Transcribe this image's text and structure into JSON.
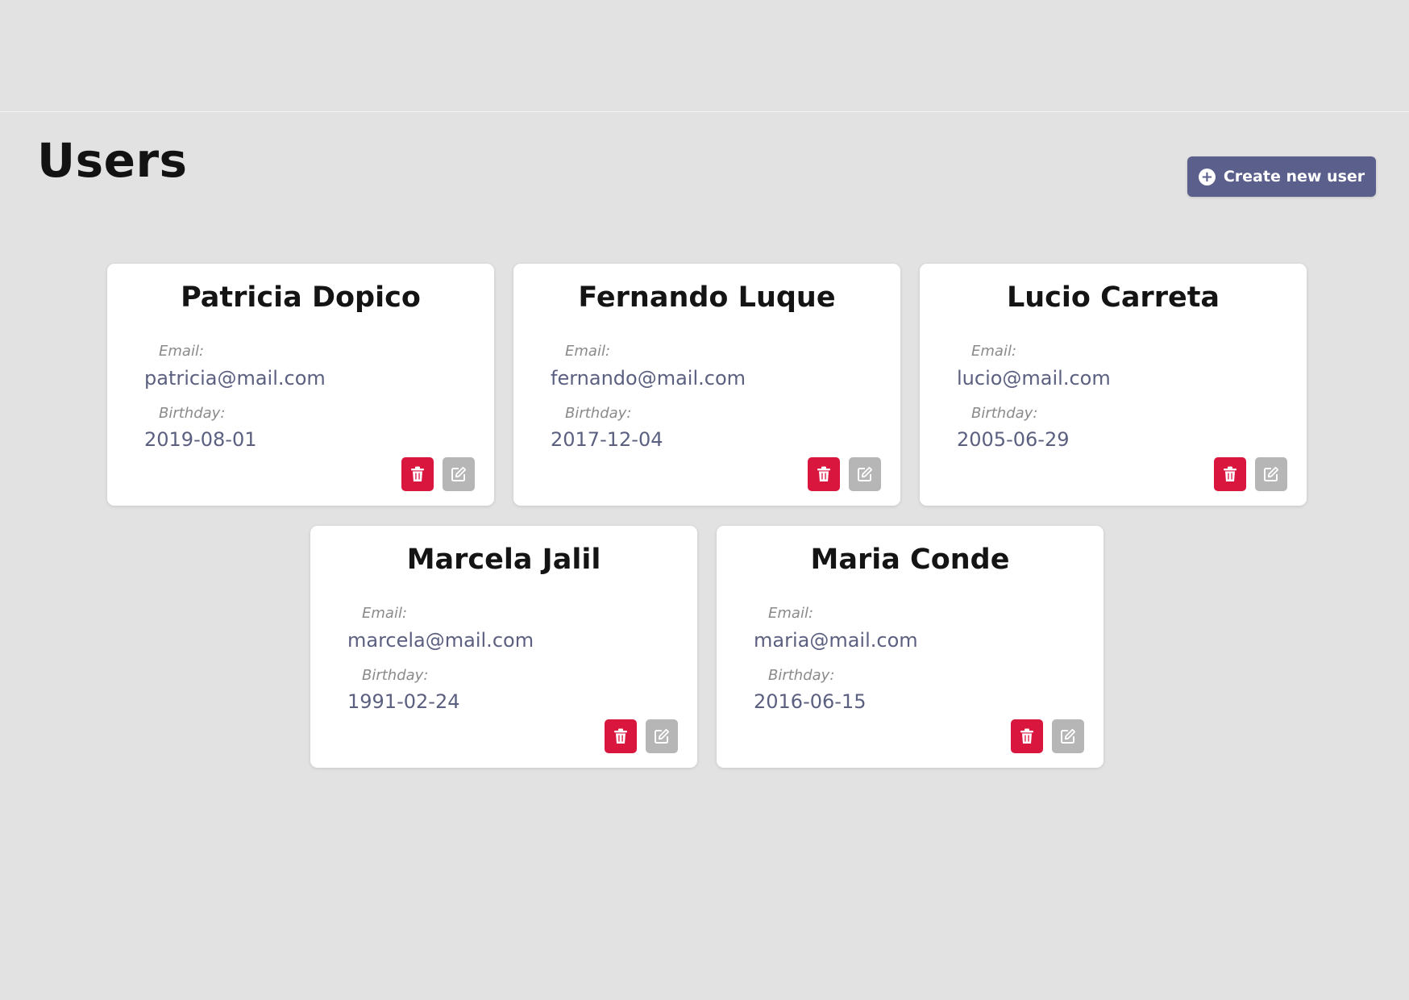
{
  "header": {
    "title": "Users",
    "create_button_label": "Create new user"
  },
  "labels": {
    "email": "Email:",
    "birthday": "Birthday:"
  },
  "colors": {
    "background": "#e2e2e2",
    "accent": "#5b5f8c",
    "delete": "#d8163e",
    "edit": "#b6b6b6",
    "value_text": "#5c6080"
  },
  "icons": {
    "create": "plus-circle-icon",
    "delete": "trash-icon",
    "edit": "edit-icon"
  },
  "users": [
    {
      "name": "Patricia Dopico",
      "email": "patricia@mail.com",
      "birthday": "2019-08-01"
    },
    {
      "name": "Fernando Luque",
      "email": "fernando@mail.com",
      "birthday": "2017-12-04"
    },
    {
      "name": "Lucio Carreta",
      "email": "lucio@mail.com",
      "birthday": "2005-06-29"
    },
    {
      "name": "Marcela Jalil",
      "email": "marcela@mail.com",
      "birthday": "1991-02-24"
    },
    {
      "name": "Maria Conde",
      "email": "maria@mail.com",
      "birthday": "2016-06-15"
    }
  ]
}
